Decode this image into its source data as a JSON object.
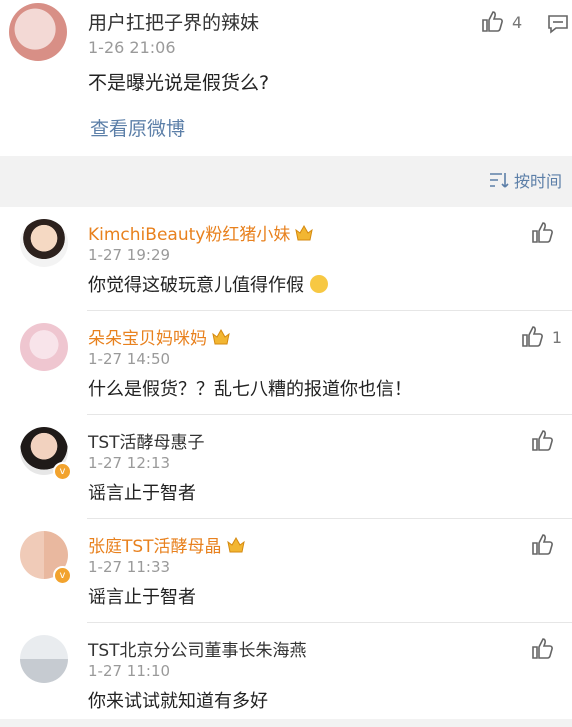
{
  "post": {
    "user": "用户扛把子界的辣妹",
    "time": "1-26 21:06",
    "like_count": "4",
    "text": "不是曝光说是假货么?",
    "view_link": "查看原微博"
  },
  "sort_label": "按时间",
  "comments": [
    {
      "name": "KimchiBeauty粉红猪小妹",
      "time": "1-27 19:29",
      "text": "你觉得这破玩意儿值得作假",
      "likes": "",
      "name_color": "#e8811e",
      "crown": true,
      "verified": false
    },
    {
      "name": "朵朵宝贝妈咪妈",
      "time": "1-27 14:50",
      "text": "什么是假货？？乱七八糟的报道你也信！",
      "likes": "1",
      "name_color": "#e8811e",
      "crown": true,
      "verified": false
    },
    {
      "name": "TST活酵母惠子",
      "time": "1-27 12:13",
      "text": "谣言止于智者",
      "likes": "",
      "name_color": "#333333",
      "crown": false,
      "verified": true
    },
    {
      "name": "张庭TST活酵母晶",
      "time": "1-27 11:33",
      "text": "谣言止于智者",
      "likes": "",
      "name_color": "#e8811e",
      "crown": true,
      "verified": true
    },
    {
      "name": "TST北京分公司董事长朱海燕",
      "time": "1-27 11:10",
      "text": "你来试试就知道有多好",
      "likes": "",
      "name_color": "#333333",
      "crown": false,
      "verified": false
    }
  ],
  "icons": [
    "thumbs-up-icon",
    "comment-icon",
    "sort-icon",
    "crown-icon",
    "verified-icon",
    "laughing-emoji-icon"
  ]
}
